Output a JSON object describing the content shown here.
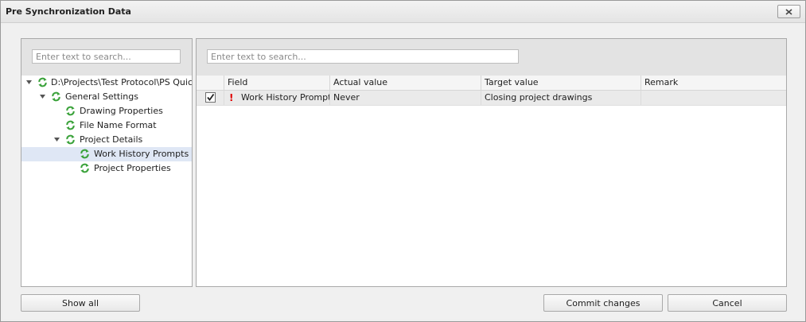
{
  "window": {
    "title": "Pre Synchronization Data",
    "close_icon": "close-x-icon"
  },
  "left_panel": {
    "search_placeholder": "Enter text to search...",
    "tree": [
      {
        "label": "D:\\Projects\\Test Protocol\\PS Quick - T",
        "icon": "sync-icon",
        "expanded": true,
        "level": 0
      },
      {
        "label": "General Settings",
        "icon": "sync-icon",
        "expanded": true,
        "level": 1
      },
      {
        "label": "Drawing Properties",
        "icon": "sync-icon",
        "level": 2
      },
      {
        "label": "File Name Format",
        "icon": "sync-icon",
        "level": 2
      },
      {
        "label": "Project Details",
        "icon": "sync-icon",
        "expanded": true,
        "level": 2
      },
      {
        "label": "Work History Prompts",
        "icon": "sync-icon",
        "selected": true,
        "level": 3
      },
      {
        "label": "Project Properties",
        "icon": "sync-icon",
        "level": 3
      }
    ]
  },
  "right_panel": {
    "search_placeholder": "Enter text to search...",
    "columns": [
      "Field",
      "Actual value",
      "Target value",
      "Remark"
    ],
    "rows": [
      {
        "checked": true,
        "status_icon": "exclamation-icon",
        "field": "Work History Prompts",
        "actual": "Never",
        "target": "Closing project drawings",
        "remark": ""
      }
    ]
  },
  "buttons": {
    "show_all": "Show all",
    "commit": "Commit changes",
    "cancel": "Cancel"
  },
  "colors": {
    "sync_icon": "#3aa23a",
    "warning": "#e00000",
    "selection": "#dfe7f5"
  }
}
